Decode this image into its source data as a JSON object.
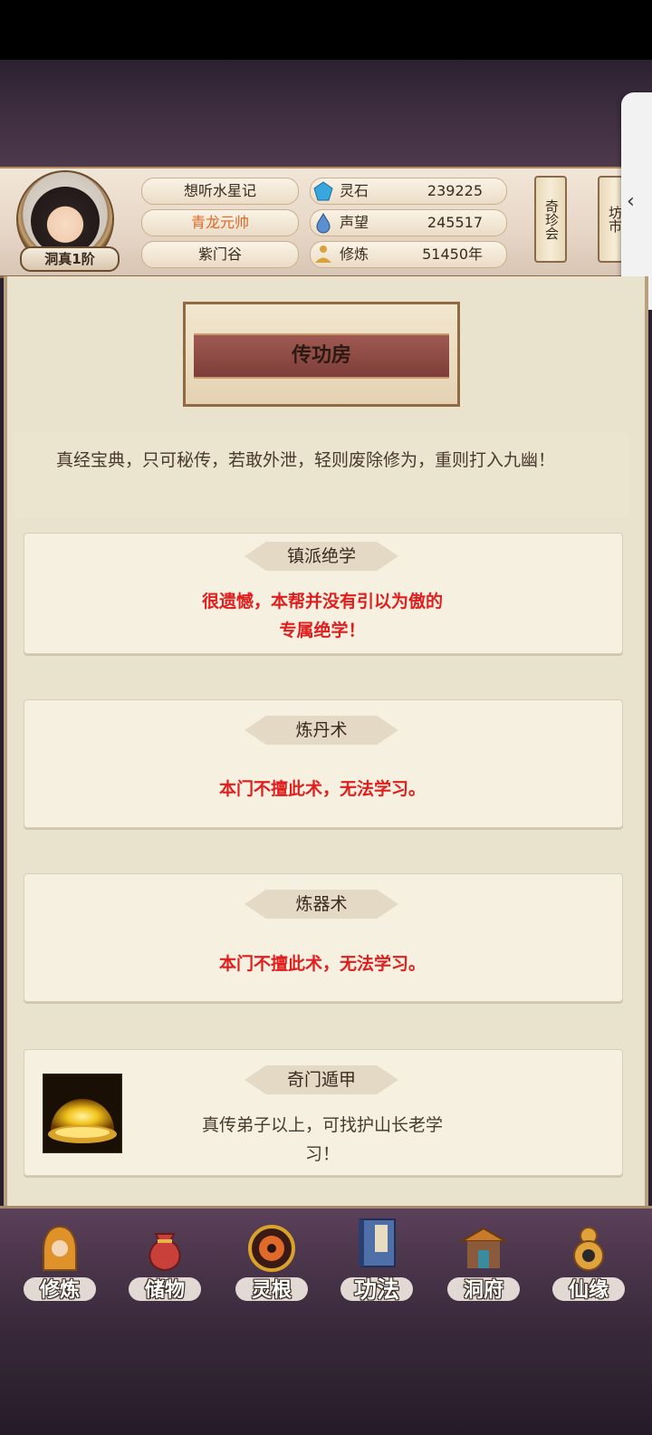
{
  "header": {
    "rank": "洞真1阶",
    "player_name": "想听水星记",
    "title": "青龙元帅",
    "sect": "紫门谷",
    "resources": [
      {
        "label": "灵石",
        "value": "239225",
        "icon": "crystal-icon",
        "color": "#3aa6e0"
      },
      {
        "label": "声望",
        "value": "245517",
        "icon": "drop-icon",
        "color": "#5a8fd0"
      },
      {
        "label": "修炼",
        "value": "51450年",
        "icon": "meditate-icon",
        "color": "#d9a23a"
      }
    ],
    "shop_button": "奇珍会",
    "market_button": "坊市",
    "side_tab_icon": "‹"
  },
  "page": {
    "title": "传功房",
    "intro": "真经宝典，只可秘传，若敢外泄，轻则废除修为，重则打入九幽！"
  },
  "sections": [
    {
      "title": "镇派绝学",
      "lines": [
        "很遗憾，本帮并没有引以为傲的",
        "专属绝学！"
      ],
      "color": "red"
    },
    {
      "title": "炼丹术",
      "lines": [
        "本门不擅此术，无法学习。"
      ],
      "color": "red"
    },
    {
      "title": "炼器术",
      "lines": [
        "本门不擅此术，无法学习。"
      ],
      "color": "red"
    },
    {
      "title": "奇门遁甲",
      "lines": [
        "真传弟子以上，可找护山长老学",
        "习！"
      ],
      "color": "brown",
      "icon": "golden-dome-icon"
    }
  ],
  "bottom_nav": [
    {
      "label": "修炼",
      "icon": "monk-icon"
    },
    {
      "label": "储物",
      "icon": "bag-icon"
    },
    {
      "label": "灵根",
      "icon": "root-icon"
    },
    {
      "label": "功法",
      "icon": "book-icon",
      "active": true
    },
    {
      "label": "洞府",
      "icon": "palace-icon"
    },
    {
      "label": "仙缘",
      "icon": "gourd-icon"
    }
  ]
}
